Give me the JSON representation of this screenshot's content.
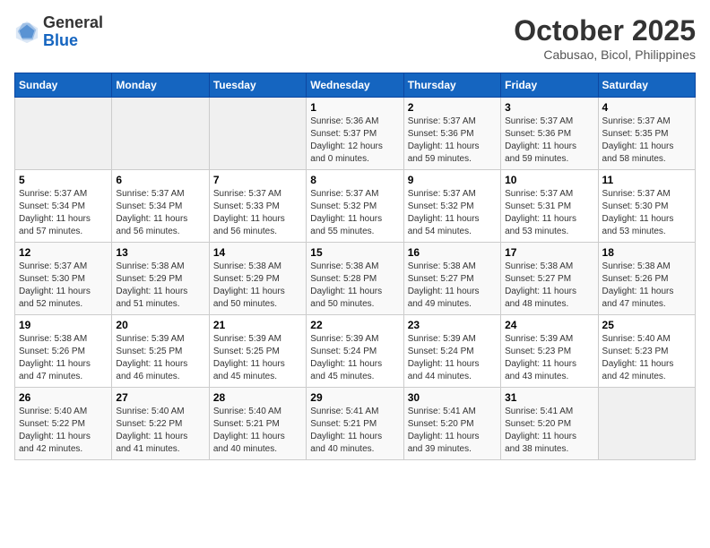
{
  "header": {
    "logo_line1": "General",
    "logo_line2": "Blue",
    "month_title": "October 2025",
    "subtitle": "Cabusao, Bicol, Philippines"
  },
  "weekdays": [
    "Sunday",
    "Monday",
    "Tuesday",
    "Wednesday",
    "Thursday",
    "Friday",
    "Saturday"
  ],
  "weeks": [
    [
      {
        "day": "",
        "info": ""
      },
      {
        "day": "",
        "info": ""
      },
      {
        "day": "",
        "info": ""
      },
      {
        "day": "1",
        "info": "Sunrise: 5:36 AM\nSunset: 5:37 PM\nDaylight: 12 hours\nand 0 minutes."
      },
      {
        "day": "2",
        "info": "Sunrise: 5:37 AM\nSunset: 5:36 PM\nDaylight: 11 hours\nand 59 minutes."
      },
      {
        "day": "3",
        "info": "Sunrise: 5:37 AM\nSunset: 5:36 PM\nDaylight: 11 hours\nand 59 minutes."
      },
      {
        "day": "4",
        "info": "Sunrise: 5:37 AM\nSunset: 5:35 PM\nDaylight: 11 hours\nand 58 minutes."
      }
    ],
    [
      {
        "day": "5",
        "info": "Sunrise: 5:37 AM\nSunset: 5:34 PM\nDaylight: 11 hours\nand 57 minutes."
      },
      {
        "day": "6",
        "info": "Sunrise: 5:37 AM\nSunset: 5:34 PM\nDaylight: 11 hours\nand 56 minutes."
      },
      {
        "day": "7",
        "info": "Sunrise: 5:37 AM\nSunset: 5:33 PM\nDaylight: 11 hours\nand 56 minutes."
      },
      {
        "day": "8",
        "info": "Sunrise: 5:37 AM\nSunset: 5:32 PM\nDaylight: 11 hours\nand 55 minutes."
      },
      {
        "day": "9",
        "info": "Sunrise: 5:37 AM\nSunset: 5:32 PM\nDaylight: 11 hours\nand 54 minutes."
      },
      {
        "day": "10",
        "info": "Sunrise: 5:37 AM\nSunset: 5:31 PM\nDaylight: 11 hours\nand 53 minutes."
      },
      {
        "day": "11",
        "info": "Sunrise: 5:37 AM\nSunset: 5:30 PM\nDaylight: 11 hours\nand 53 minutes."
      }
    ],
    [
      {
        "day": "12",
        "info": "Sunrise: 5:37 AM\nSunset: 5:30 PM\nDaylight: 11 hours\nand 52 minutes."
      },
      {
        "day": "13",
        "info": "Sunrise: 5:38 AM\nSunset: 5:29 PM\nDaylight: 11 hours\nand 51 minutes."
      },
      {
        "day": "14",
        "info": "Sunrise: 5:38 AM\nSunset: 5:29 PM\nDaylight: 11 hours\nand 50 minutes."
      },
      {
        "day": "15",
        "info": "Sunrise: 5:38 AM\nSunset: 5:28 PM\nDaylight: 11 hours\nand 50 minutes."
      },
      {
        "day": "16",
        "info": "Sunrise: 5:38 AM\nSunset: 5:27 PM\nDaylight: 11 hours\nand 49 minutes."
      },
      {
        "day": "17",
        "info": "Sunrise: 5:38 AM\nSunset: 5:27 PM\nDaylight: 11 hours\nand 48 minutes."
      },
      {
        "day": "18",
        "info": "Sunrise: 5:38 AM\nSunset: 5:26 PM\nDaylight: 11 hours\nand 47 minutes."
      }
    ],
    [
      {
        "day": "19",
        "info": "Sunrise: 5:38 AM\nSunset: 5:26 PM\nDaylight: 11 hours\nand 47 minutes."
      },
      {
        "day": "20",
        "info": "Sunrise: 5:39 AM\nSunset: 5:25 PM\nDaylight: 11 hours\nand 46 minutes."
      },
      {
        "day": "21",
        "info": "Sunrise: 5:39 AM\nSunset: 5:25 PM\nDaylight: 11 hours\nand 45 minutes."
      },
      {
        "day": "22",
        "info": "Sunrise: 5:39 AM\nSunset: 5:24 PM\nDaylight: 11 hours\nand 45 minutes."
      },
      {
        "day": "23",
        "info": "Sunrise: 5:39 AM\nSunset: 5:24 PM\nDaylight: 11 hours\nand 44 minutes."
      },
      {
        "day": "24",
        "info": "Sunrise: 5:39 AM\nSunset: 5:23 PM\nDaylight: 11 hours\nand 43 minutes."
      },
      {
        "day": "25",
        "info": "Sunrise: 5:40 AM\nSunset: 5:23 PM\nDaylight: 11 hours\nand 42 minutes."
      }
    ],
    [
      {
        "day": "26",
        "info": "Sunrise: 5:40 AM\nSunset: 5:22 PM\nDaylight: 11 hours\nand 42 minutes."
      },
      {
        "day": "27",
        "info": "Sunrise: 5:40 AM\nSunset: 5:22 PM\nDaylight: 11 hours\nand 41 minutes."
      },
      {
        "day": "28",
        "info": "Sunrise: 5:40 AM\nSunset: 5:21 PM\nDaylight: 11 hours\nand 40 minutes."
      },
      {
        "day": "29",
        "info": "Sunrise: 5:41 AM\nSunset: 5:21 PM\nDaylight: 11 hours\nand 40 minutes."
      },
      {
        "day": "30",
        "info": "Sunrise: 5:41 AM\nSunset: 5:20 PM\nDaylight: 11 hours\nand 39 minutes."
      },
      {
        "day": "31",
        "info": "Sunrise: 5:41 AM\nSunset: 5:20 PM\nDaylight: 11 hours\nand 38 minutes."
      },
      {
        "day": "",
        "info": ""
      }
    ]
  ]
}
